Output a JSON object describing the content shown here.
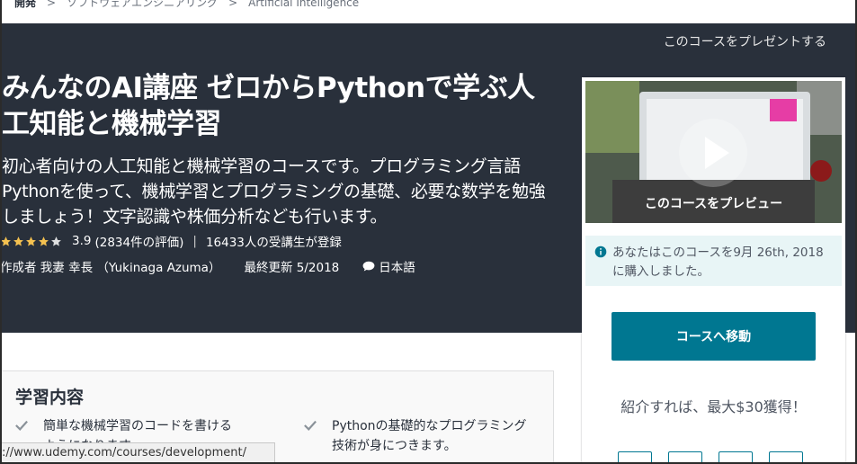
{
  "breadcrumb": {
    "items": [
      "開発",
      "ソフトウェアエンジニアリング",
      "Artificial Intelligence"
    ],
    "separator": ">"
  },
  "hero": {
    "gift_label": "このコースをプレゼントする",
    "title": "みんなのAI講座 ゼロからPythonで学ぶ人工知能と機械学習",
    "subtitle": "初心者向けの人工知能と機械学習のコースです。プログラミング言語Pythonを使って、機械学習とプログラミングの基礎、必要な数学を勉強しましょう！文字認識や株価分析なども行います。",
    "rating": {
      "value": "3.9",
      "stars": 4,
      "count_text": "(2834件の評価)",
      "students_text": "16433人の受講生が登録"
    },
    "meta": {
      "author": "作成者 我妻 幸長 （Yukinaga Azuma）",
      "updated": "最終更新 5/2018",
      "language": "日本語"
    }
  },
  "sidebar": {
    "preview_label": "このコースをプレビュー",
    "purchase_notice": "あなたはこのコースを9月 26th, 2018に購入しました。",
    "go_button": "コースへ移動",
    "referral_text": "紹介すれば、最大$30獲得！"
  },
  "learn": {
    "title": "学習内容",
    "items": [
      "簡単な機械学習のコードを書けるようになります。",
      "Pythonの基礎的なプログラミング技術が身につきます。"
    ]
  },
  "status_url": "://www.udemy.com/courses/development/",
  "colors": {
    "hero_bg": "#29303b",
    "accent": "#007791",
    "star": "#f4c150"
  }
}
